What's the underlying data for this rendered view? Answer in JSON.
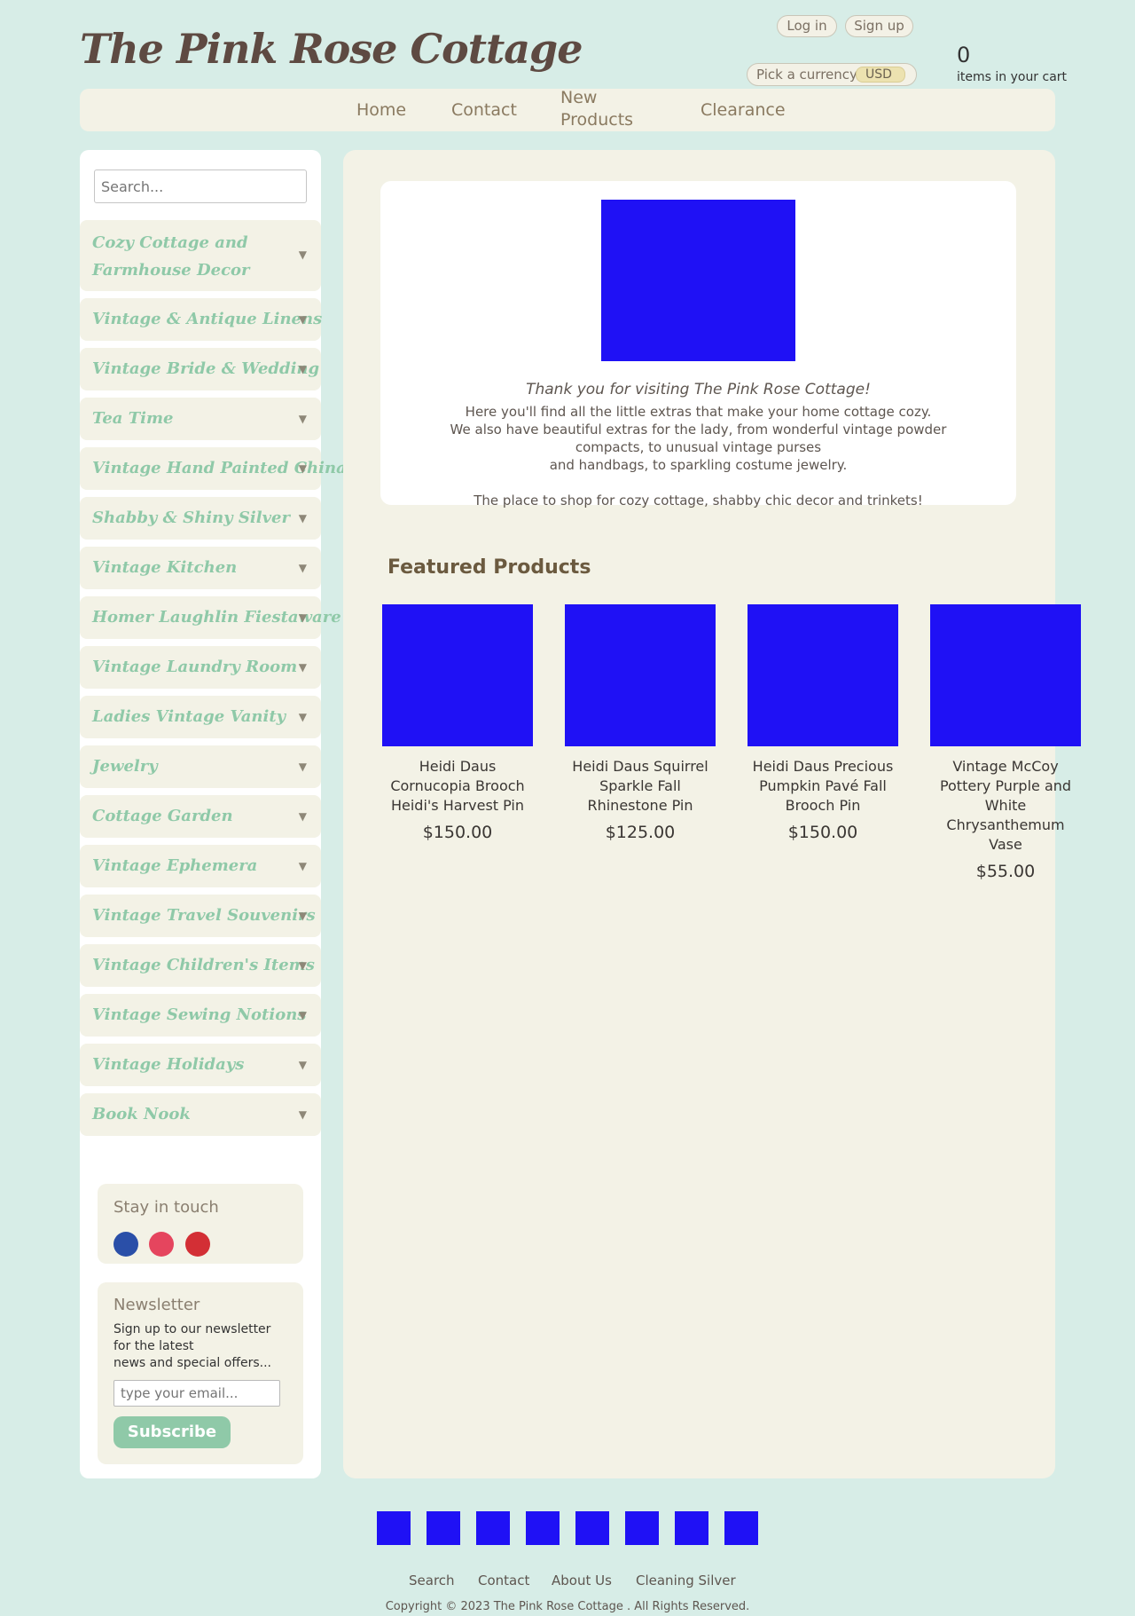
{
  "header": {
    "site_title": "The Pink Rose Cottage",
    "login": "Log in",
    "signup": "Sign up",
    "currency_label": "Pick a currency",
    "currency_value": "USD",
    "cart_count": "0",
    "cart_label": "items in your cart"
  },
  "nav": {
    "home": "Home",
    "contact": "Contact",
    "new_products": "New Products",
    "clearance": "Clearance"
  },
  "sidebar": {
    "search_placeholder": "Search...",
    "categories": [
      "Cozy Cottage and Farmhouse Decor",
      "Vintage & Antique Linens",
      "Vintage Bride & Wedding",
      "Tea Time",
      "Vintage Hand Painted China",
      "Shabby & Shiny Silver",
      "Vintage Kitchen",
      "Homer Laughlin Fiestaware",
      "Vintage Laundry Room",
      "Ladies Vintage Vanity",
      "Jewelry",
      "Cottage Garden",
      "Vintage Ephemera",
      "Vintage Travel Souvenirs",
      "Vintage Children's Items",
      "Vintage Sewing Notions",
      "Vintage Holidays",
      "Book Nook"
    ],
    "arrow": "▼",
    "stay_in_touch": "Stay in touch",
    "social_colors": [
      "#2a4fa8",
      "#e5455e",
      "#d32f35"
    ],
    "newsletter_title": "Newsletter",
    "newsletter_text_1": "Sign up to our newsletter for the latest",
    "newsletter_text_2": "news and special offers...",
    "email_placeholder": "type your email...",
    "subscribe": "Subscribe"
  },
  "welcome": {
    "heading": "Thank you for visiting The Pink Rose Cottage!",
    "line1": "Here you'll find all the little extras that make your home cottage cozy.",
    "line2": "We also have beautiful extras for the lady, from wonderful vintage powder compacts, to unusual vintage purses",
    "line3": "and handbags, to sparkling costume jewelry.",
    "line4": "The place to shop for cozy cottage, shabby chic decor and trinkets!"
  },
  "featured": {
    "title": "Featured Products",
    "products": [
      {
        "name": "Heidi Daus Cornucopia Brooch Heidi's Harvest Pin",
        "price": "$150.00"
      },
      {
        "name": "Heidi Daus Squirrel Sparkle Fall Rhinestone Pin",
        "price": "$125.00"
      },
      {
        "name": "Heidi Daus Precious Pumpkin Pavé Fall Brooch Pin",
        "price": "$150.00"
      },
      {
        "name": "Vintage McCoy Pottery Purple and White Chrysanthemum Vase",
        "price": "$55.00"
      }
    ]
  },
  "footer": {
    "links": [
      "Search",
      "Contact",
      "About Us",
      "Cleaning Silver"
    ],
    "copyright": "Copyright © 2023 The Pink Rose Cottage . All Rights Reserved."
  }
}
